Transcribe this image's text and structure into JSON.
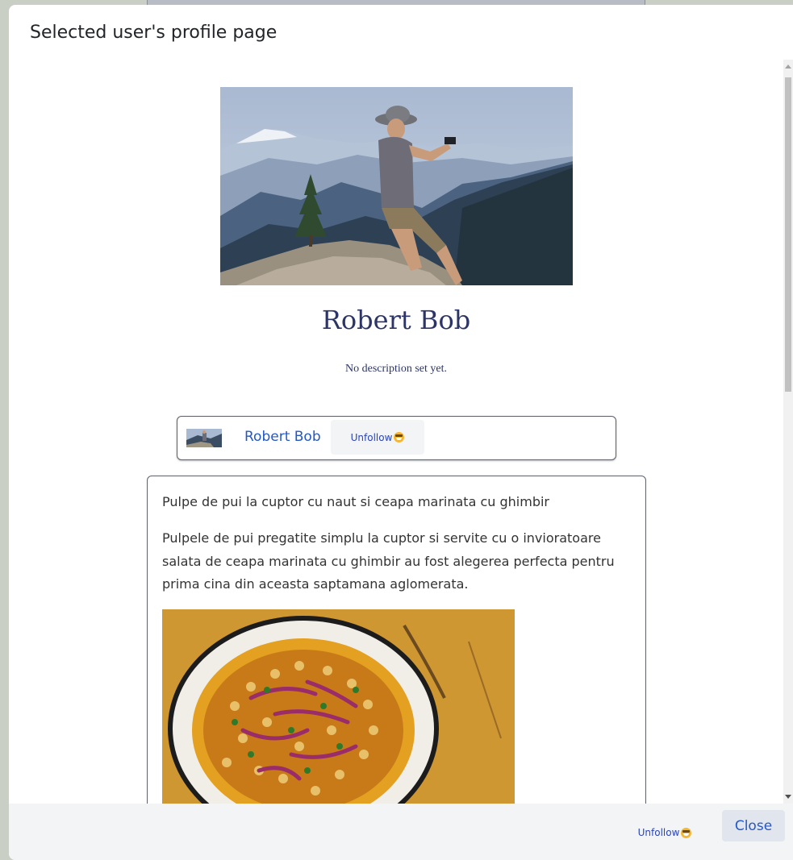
{
  "modal": {
    "title": "Selected user's profile page"
  },
  "profile": {
    "name": "Robert Bob",
    "description": "No description set yet.",
    "cover_alt": "hiker taking a photo on a mountain summit"
  },
  "user_card": {
    "name": "Robert Bob",
    "unfollow_label": "Unfollow"
  },
  "post": {
    "title": "Pulpe de pui la cuptor cu naut si ceapa marinata cu ghimbir",
    "text": "Pulpele de pui pregatite simplu la cuptor si servite cu o invioratoare salata de ceapa marinata cu ghimbir au fost alegerea perfecta pentru prima cina din aceasta saptamana aglomerata.",
    "image_alt": "plate of chickpeas with pickled red onion and herbs"
  },
  "footer": {
    "unfollow_label": "Unfollow",
    "close_label": "Close"
  },
  "colors": {
    "accent": "#2458c6",
    "profile_name": "#2c3566",
    "footer_bg": "#f3f4f6"
  },
  "icons": {
    "unfollow": "grinning-face-emoji"
  }
}
